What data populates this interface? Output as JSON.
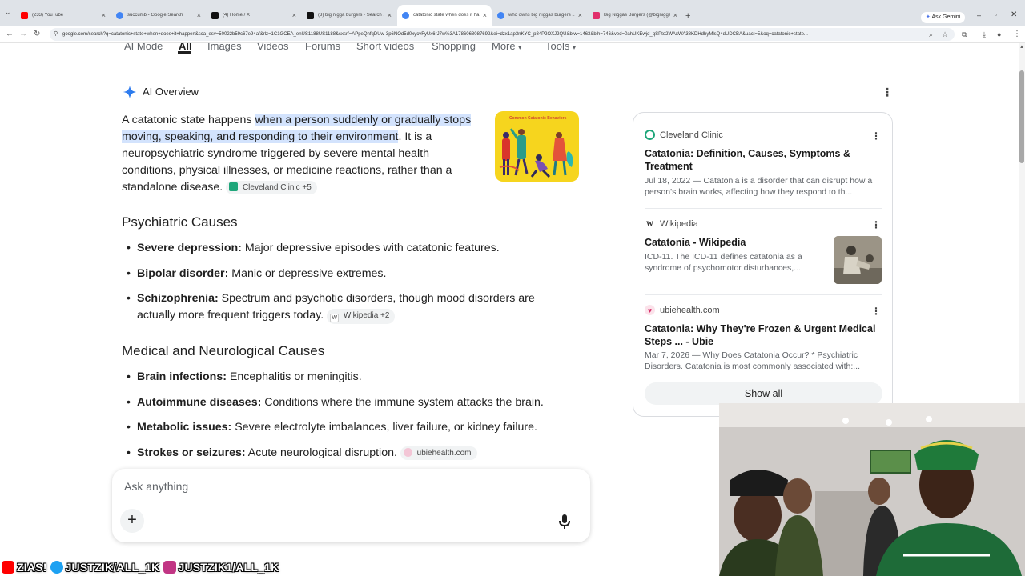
{
  "browser": {
    "tabs": [
      {
        "title": "(233) YouTube",
        "favicon_color": "#ff0000",
        "active": false
      },
      {
        "title": "succumb - Google Search",
        "favicon_color": "#4285f4",
        "active": false
      },
      {
        "title": "(4) Home / X",
        "favicon_color": "#111111",
        "active": false
      },
      {
        "title": "(3) big nigga burgers - Search ...",
        "favicon_color": "#111111",
        "active": false
      },
      {
        "title": "catatonic state when does it ha...",
        "favicon_color": "#4285f4",
        "active": true
      },
      {
        "title": "who owns big niggas burgers ...",
        "favicon_color": "#4285f4",
        "active": false
      },
      {
        "title": "Big Niggas Burgers (@bignigga...",
        "favicon_color": "#e1306c",
        "active": false
      }
    ],
    "new_tab": "+",
    "ask_gemini": "Ask Gemini",
    "url": "google.com/search?q=catatonic+state+when+does+it+happen&sca_esv=50022b59c67e94af&rlz=1C1GCEA_enUS1188US1188&sxsrf=APpeQnfqDUw-3p6NOd5d0xycvFyUx6rJ7w%3A1786068087692&ei=dzx1ap3nKYC_p84P2OXJ2QU&biw=1463&bih=746&ved=0ahUKEwjd_qSPto2WAxWA38KDHdhyMlsQ4dUDCBA&uact=5&oq=catatonic+state..."
  },
  "search_tabs": [
    "AI Mode",
    "All",
    "Images",
    "Videos",
    "Forums",
    "Short videos",
    "Shopping",
    "More",
    "Tools"
  ],
  "active_search_tab": "All",
  "ai_overview": {
    "title": "AI Overview",
    "intro_before": "A catatonic state happens ",
    "intro_highlight": "when a person suddenly or gradually stops moving, speaking, and responding to their environment",
    "intro_after": ". It is a neuropsychiatric syndrome triggered by severe mental health conditions, physical illnesses, or medicine reactions, rather than a standalone disease.",
    "intro_chip": "Cleveland Clinic +5",
    "thumbnail_caption": "Common Catatonic Behaviors",
    "sections": [
      {
        "heading": "Psychiatric Causes",
        "items": [
          {
            "term": "Severe depression:",
            "text": " Major depressive episodes with catatonic features.",
            "chip": ""
          },
          {
            "term": "Bipolar disorder:",
            "text": " Manic or depressive extremes.",
            "chip": ""
          },
          {
            "term": "Schizophrenia:",
            "text": " Spectrum and psychotic disorders, though mood disorders are actually more frequent triggers today.",
            "chip": "Wikipedia +2"
          }
        ]
      },
      {
        "heading": "Medical and Neurological Causes",
        "items": [
          {
            "term": "Brain infections:",
            "text": " Encephalitis or meningitis.",
            "chip": ""
          },
          {
            "term": "Autoimmune diseases:",
            "text": " Conditions where the immune system attacks the brain.",
            "chip": ""
          },
          {
            "term": "Metabolic issues:",
            "text": " Severe electrolyte imbalances, liver failure, or kidney failure.",
            "chip": ""
          },
          {
            "term": "Strokes or seizures:",
            "text": " Acute neurological disruption.",
            "chip": "ubiehealth.com"
          }
        ]
      }
    ]
  },
  "sources": {
    "items": [
      {
        "site": "Cleveland Clinic",
        "site_icon": "C",
        "title": "Catatonia: Definition, Causes, Symptoms & Treatment",
        "snippet": "Jul 18, 2022 — Catatonia is a disorder that can disrupt how a person's brain works, affecting how they respond to th..."
      },
      {
        "site": "Wikipedia",
        "site_icon": "W",
        "title": "Catatonia - Wikipedia",
        "snippet": "ICD-11. The ICD-11 defines catatonia as a syndrome of psychomotor disturbances,..."
      },
      {
        "site": "ubiehealth.com",
        "site_icon": "♥",
        "title": "Catatonia: Why They're Frozen & Urgent Medical Steps ... - Ubie",
        "snippet": "Mar 7, 2026 — Why Does Catatonia Occur? * Psychiatric Disorders. Catatonia is most commonly associated with:..."
      }
    ],
    "show_all": "Show all"
  },
  "ask_bar": {
    "placeholder": "Ask anything",
    "plus": "+"
  },
  "overlay": {
    "youtube_handle": "ZIAS!",
    "twitter_handle": "JUSTZIK/ALL_1K",
    "instagram_handle": "JUSTZIK1/ALL_1K"
  },
  "colors": {
    "highlight": "#d3e3fd",
    "chip_bg": "#f1f3f4",
    "link_dark": "#1a1a1a",
    "thumbnail_bg": "#f6d51e"
  }
}
